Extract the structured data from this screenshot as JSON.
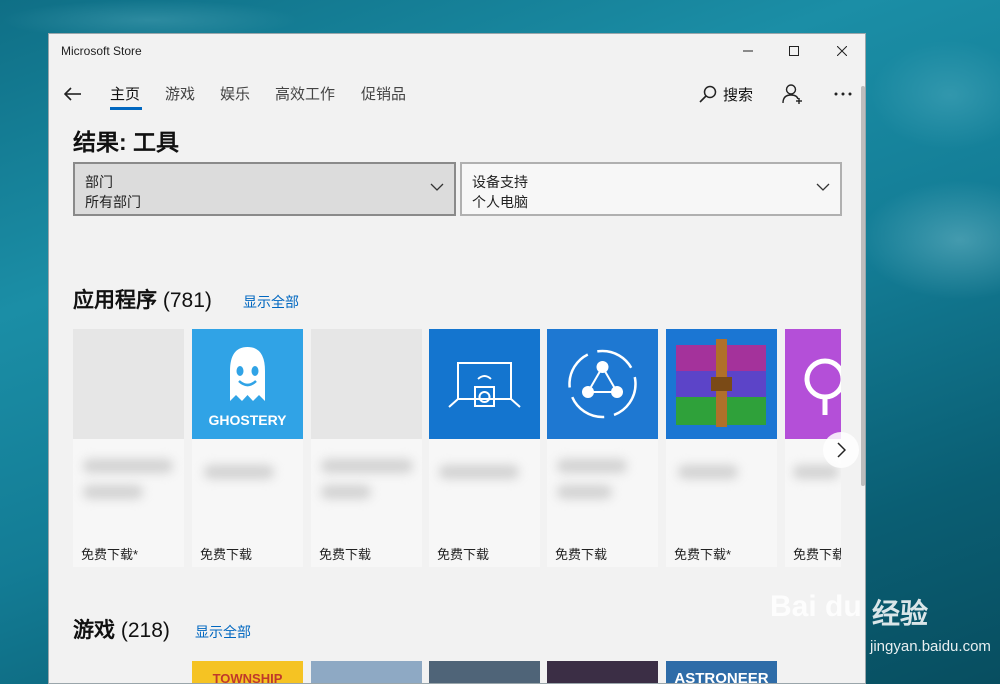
{
  "window": {
    "title": "Microsoft Store"
  },
  "nav": {
    "tabs": [
      {
        "label": "主页",
        "active": true
      },
      {
        "label": "游戏"
      },
      {
        "label": "娱乐"
      },
      {
        "label": "高效工作"
      },
      {
        "label": "促销品"
      }
    ],
    "search_label": "搜索"
  },
  "results": {
    "heading": "结果: 工具",
    "filters": [
      {
        "label": "部门",
        "value": "所有部门"
      },
      {
        "label": "设备支持",
        "value": "个人电脑"
      }
    ]
  },
  "apps": {
    "title": "应用程序",
    "count": "(781)",
    "show_all": "显示全部",
    "items": [
      {
        "icon": "blank-icon",
        "price": "免费下载*",
        "bg": "#e6e6e6"
      },
      {
        "icon": "ghostery-icon",
        "icon_text": "GHOSTERY",
        "price": "免费下载",
        "bg": "#30a3e6"
      },
      {
        "icon": "blank-icon",
        "price": "免费下载",
        "bg": "#e6e6e6"
      },
      {
        "icon": "cast-screen-icon",
        "price": "免费下载",
        "bg": "#1475cf"
      },
      {
        "icon": "share-icon",
        "price": "免费下载",
        "bg": "#1e78d2"
      },
      {
        "icon": "winrar-icon",
        "price": "免费下载*",
        "bg": "#1b76d3"
      },
      {
        "icon": "podcast-icon",
        "price": "免费下载",
        "bg": "#b44fd8"
      }
    ]
  },
  "games": {
    "title": "游戏",
    "count": "(218)",
    "show_all": "显示全部",
    "tiles": [
      {
        "label": "TOWNSHIP",
        "bg": "#f5c323"
      },
      {
        "label": "",
        "bg": "#8ea9c4"
      },
      {
        "label": "",
        "bg": "#4f6478"
      },
      {
        "label": "",
        "bg": "#3b2e45"
      },
      {
        "label": "ASTRONEER",
        "bg": "#2e6ca8"
      }
    ]
  },
  "watermark": {
    "logo": "Bai du",
    "sub": "经验",
    "url": "jingyan.baidu.com"
  },
  "colors": {
    "accent": "#0067c0",
    "background": "#f2f2f2"
  }
}
